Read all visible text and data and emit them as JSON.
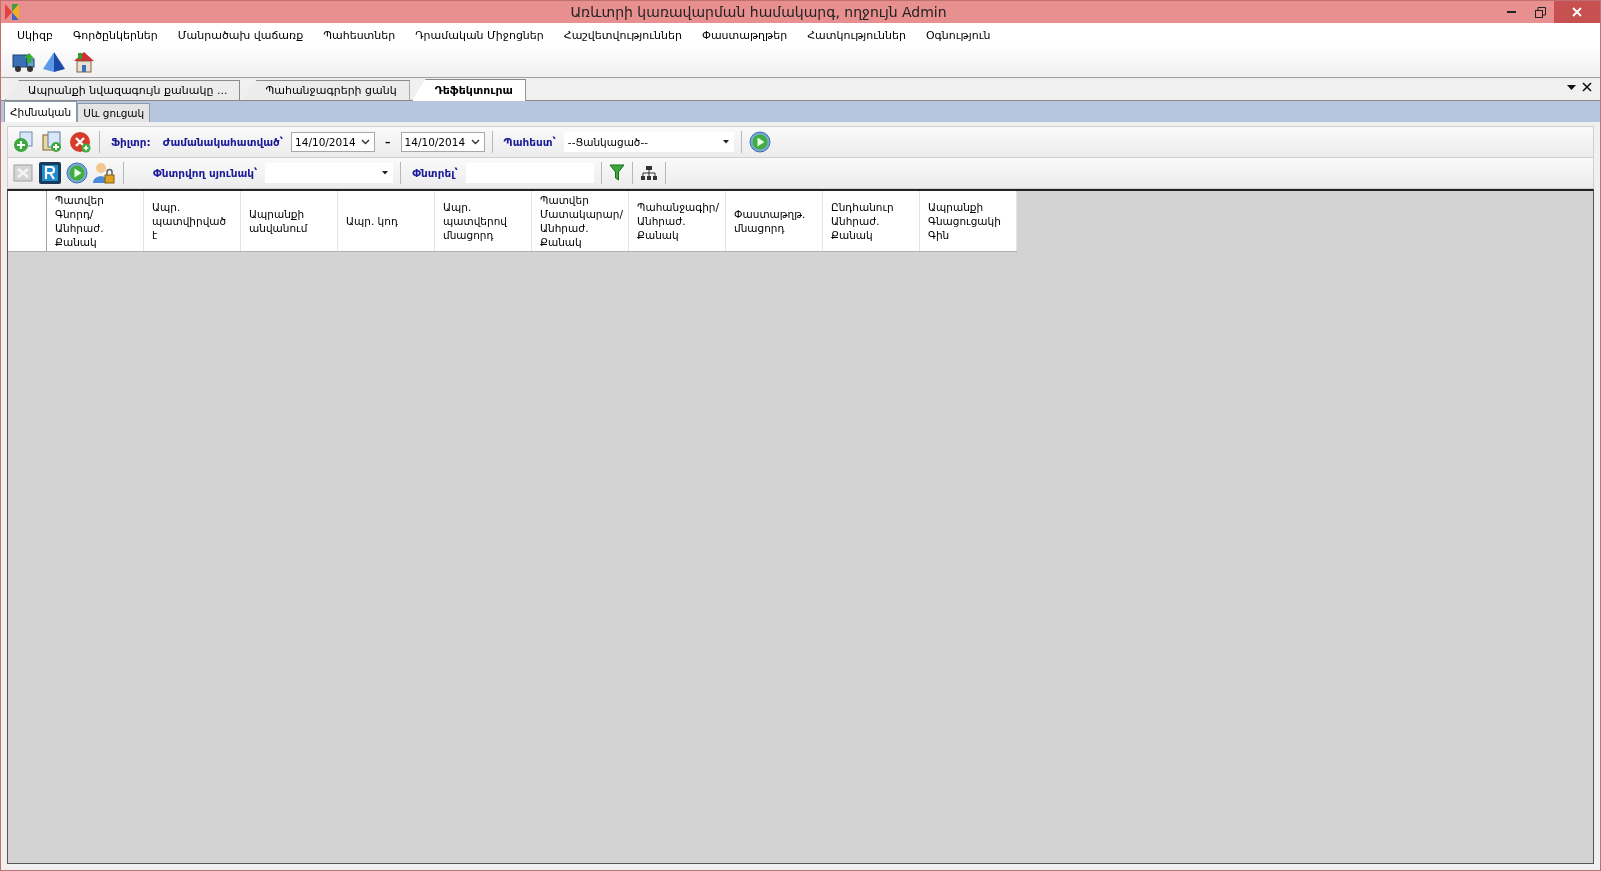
{
  "window": {
    "title": "Առևտրի կառավարման համակարգ, ողջույն Admin"
  },
  "menu": [
    "Սկիզբ",
    "Գործընկերներ",
    "Մանրածախ վաճառք",
    "Պահեստներ",
    "Դրամական Միջոցներ",
    "Հաշվետվություններ",
    "Փաստաթղթեր",
    "Հատկություններ",
    "Օգնություն"
  ],
  "tabs": [
    {
      "label": "Ապրանքի նվազագույն քանակը ...",
      "selected": false
    },
    {
      "label": "Պահանջագրերի ցանկ",
      "selected": false
    },
    {
      "label": "Դեֆեկտուրա",
      "selected": true
    }
  ],
  "subtabs": [
    {
      "label": "Հիմնական",
      "selected": true
    },
    {
      "label": "Սև ցուցակ",
      "selected": false
    }
  ],
  "filter": {
    "label": "Ֆիլտր:",
    "period_label": "Ժամանակահատված՝",
    "date_from": "14/10/2014",
    "dash": "–",
    "date_to": "14/10/2014",
    "warehouse_label": "Պահեստ՝",
    "warehouse": "--Ցանկացած--"
  },
  "search": {
    "column_label": "Փնտրվող սյունակ՝",
    "search_label": "Փնտրել՝"
  },
  "table": {
    "columns": [
      "Պատվեր Գնորդ/ Անհրաժ. Քանակ",
      "Ապր. պատվիրված է",
      "Ապրանքի անվանում",
      "Ապր. կոդ",
      "Ապր. պատվերով մնացորդ",
      "Պատվեր Մատակարար/ Անհրաժ. Քանակ",
      "Պահանջագիր/ Անհրաժ. Քանակ",
      "Փաստաթղթ. մնացորդ",
      "Ընդհանուր Անհրաժ. Քանակ",
      "Ապրանքի Գնացուցակի Գին"
    ]
  }
}
